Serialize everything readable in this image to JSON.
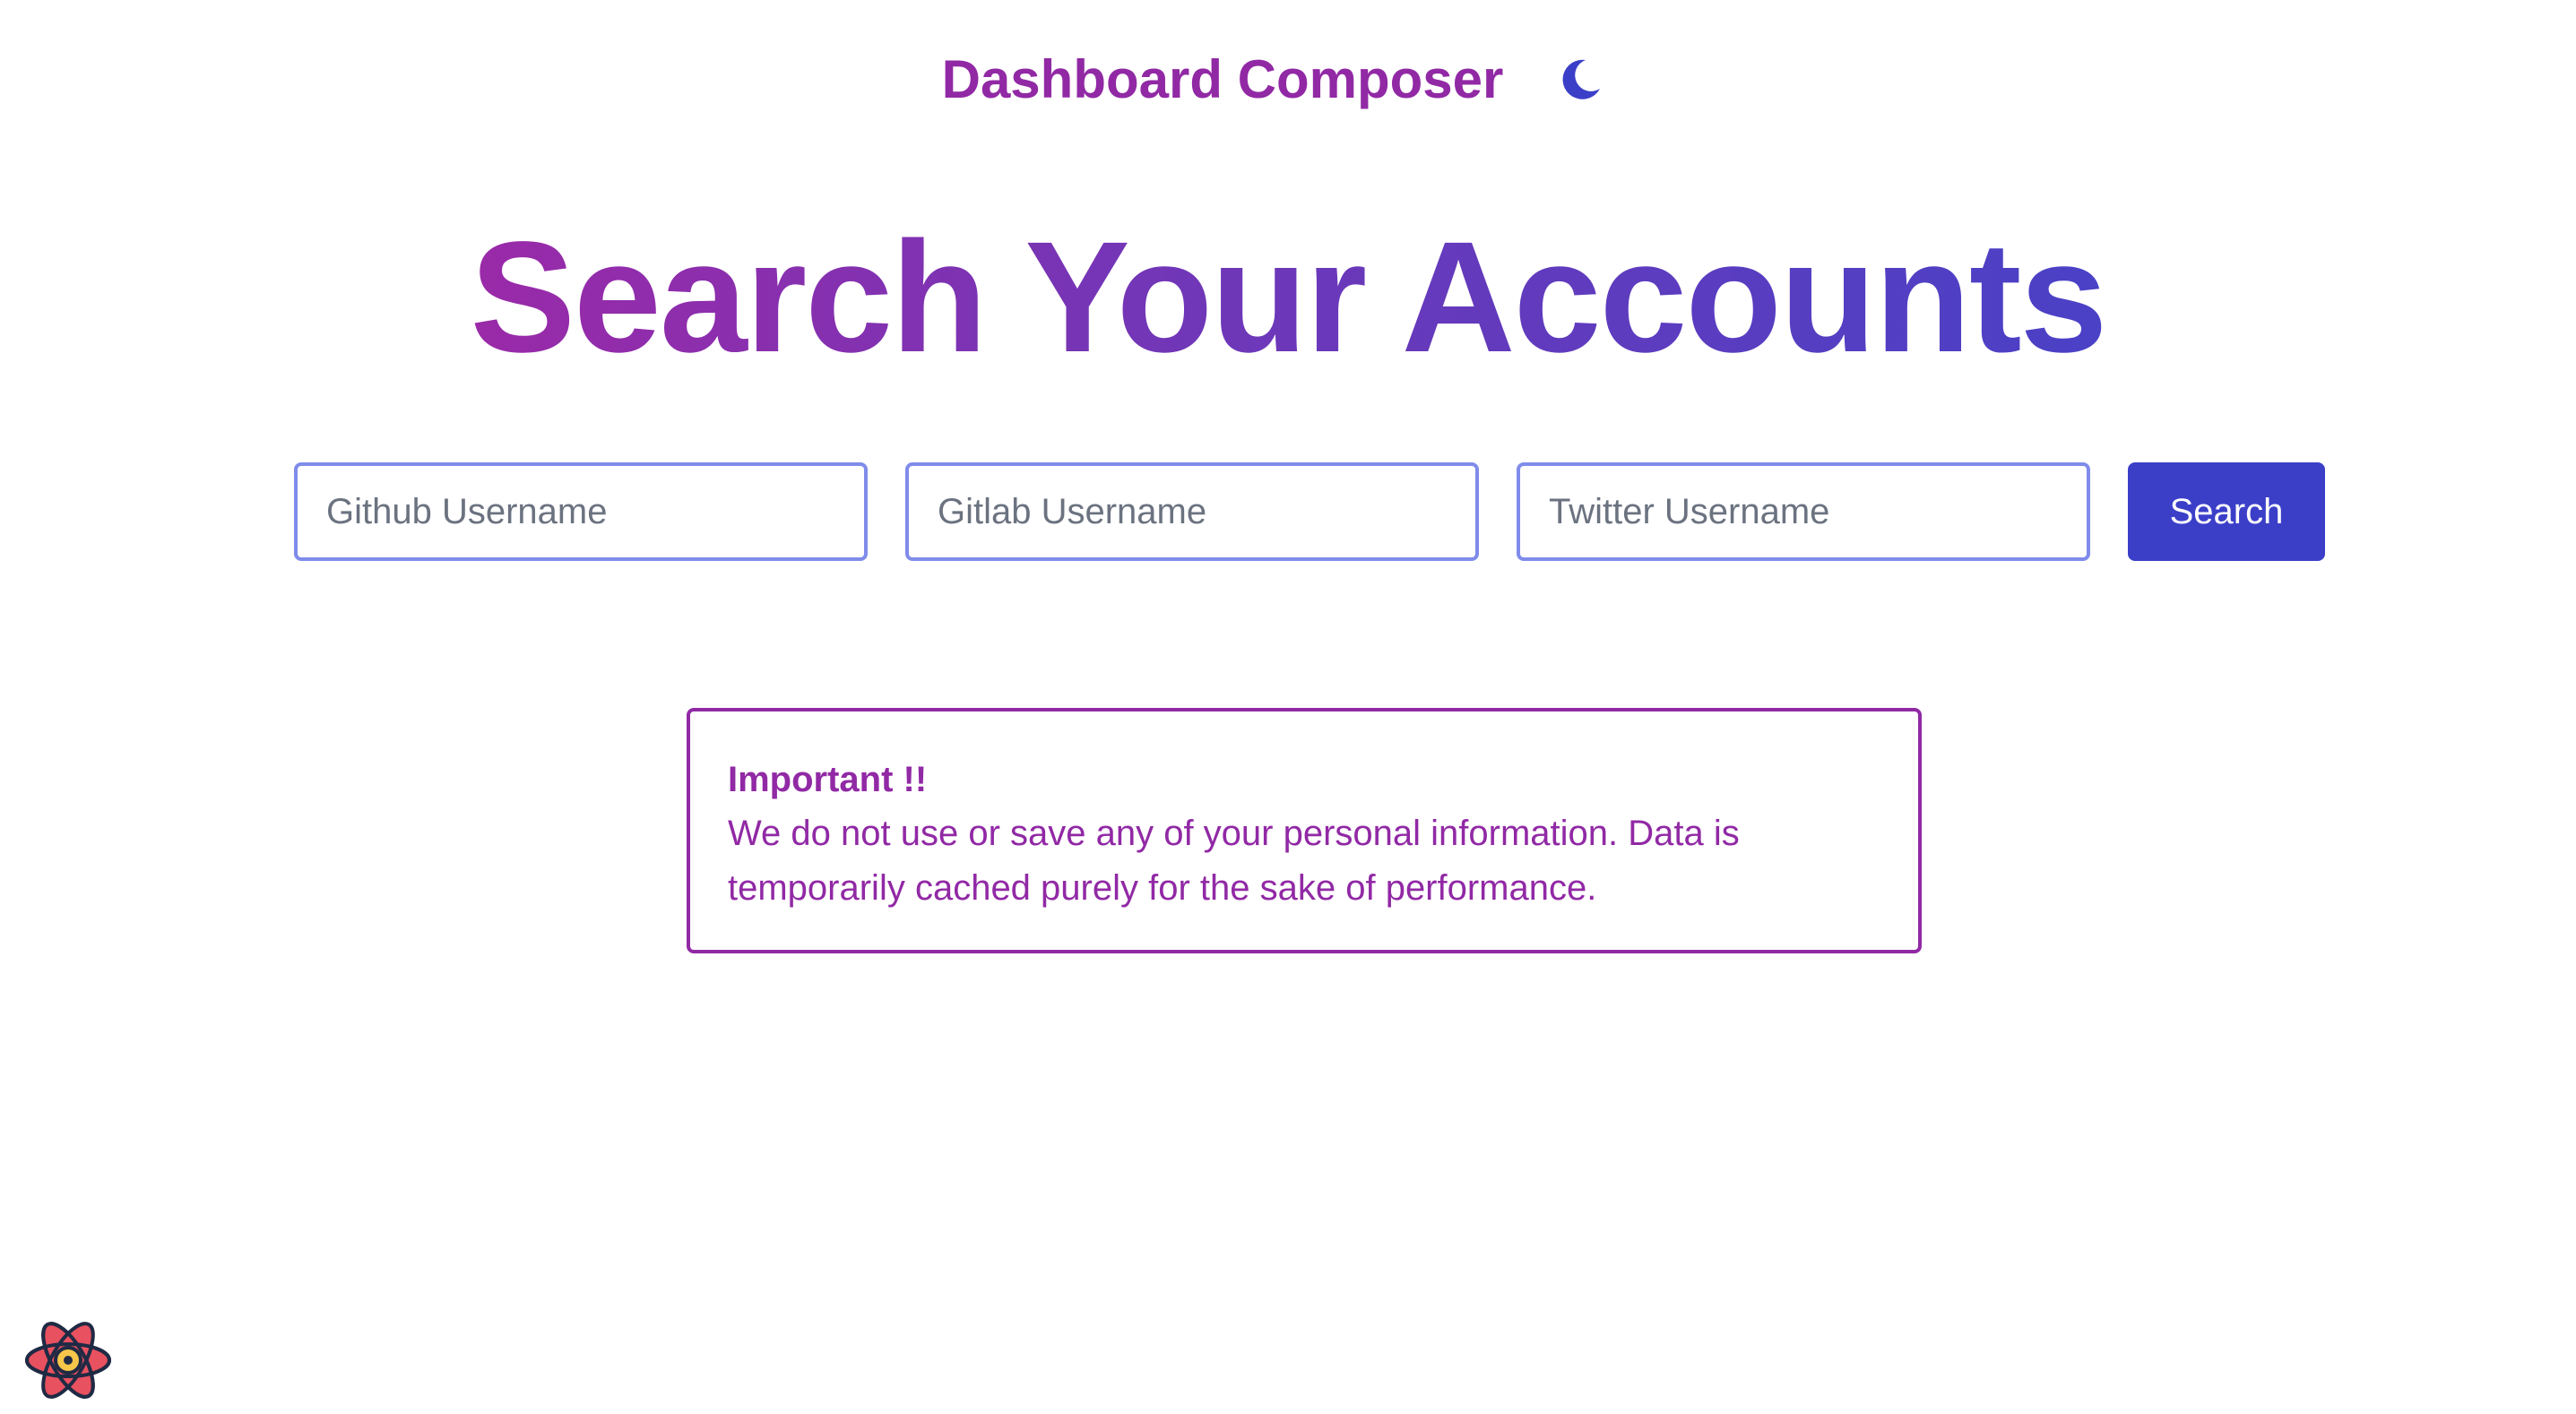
{
  "header": {
    "brand": "Dashboard Composer",
    "theme_icon": "moon-icon"
  },
  "hero": {
    "title": "Search Your Accounts"
  },
  "search": {
    "github_placeholder": "Github Username",
    "gitlab_placeholder": "Gitlab Username",
    "twitter_placeholder": "Twitter Username",
    "github_value": "",
    "gitlab_value": "",
    "twitter_value": "",
    "button_label": "Search"
  },
  "notice": {
    "title": "Important !!",
    "body": "We do not use or save any of your personal information. Data is temporarily cached purely for the sake of performance."
  },
  "footer": {
    "logo_icon": "atom-logo-icon"
  },
  "colors": {
    "brand": "#9129a5",
    "accent": "#3b3fc8",
    "input_border": "#7f8cea"
  }
}
